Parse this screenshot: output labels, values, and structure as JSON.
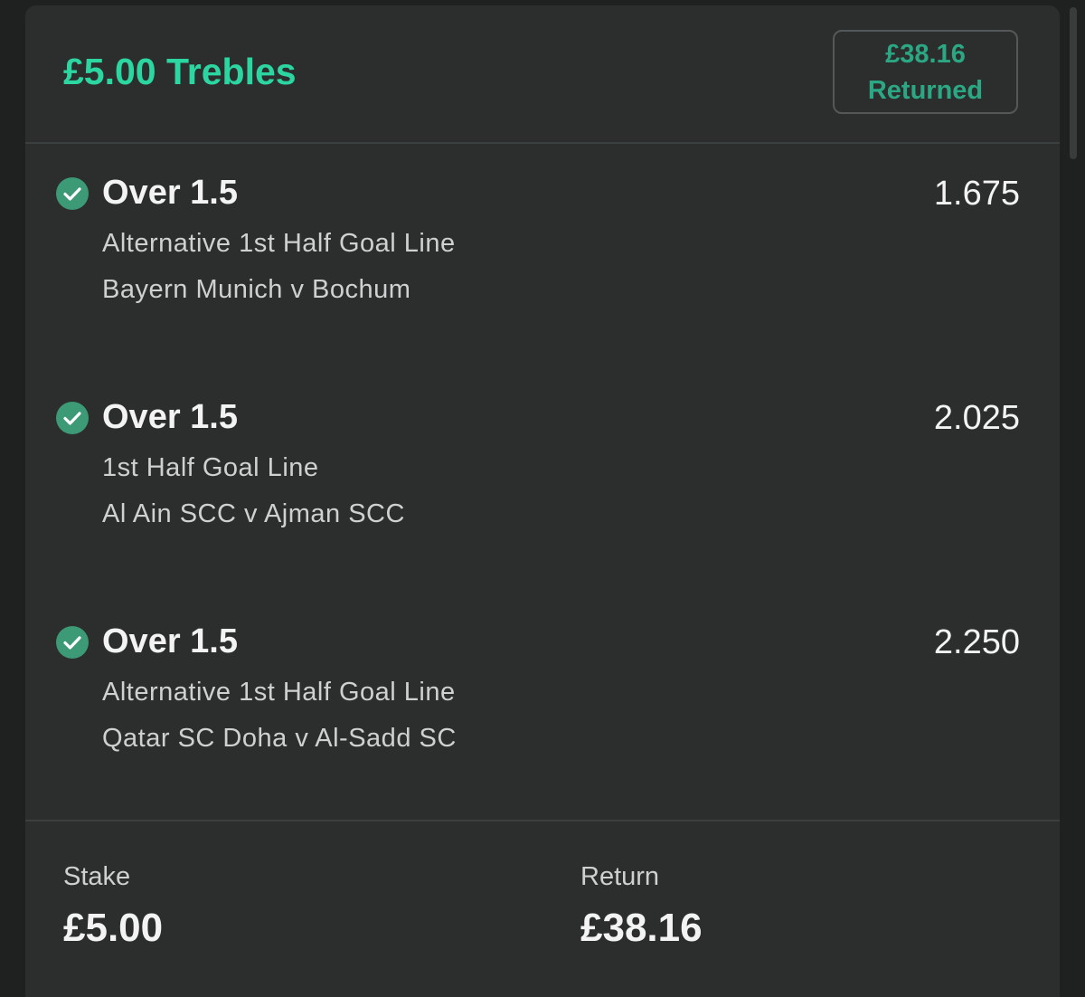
{
  "header": {
    "title": "£5.00 Trebles",
    "returned_amount": "£38.16",
    "returned_label": "Returned"
  },
  "selections": [
    {
      "name": "Over 1.5",
      "market": "Alternative 1st Half Goal Line",
      "event": "Bayern Munich v Bochum",
      "odds": "1.675",
      "status_icon": "check-circle-icon"
    },
    {
      "name": "Over 1.5",
      "market": "1st Half Goal Line",
      "event": "Al Ain SCC v Ajman SCC",
      "odds": "2.025",
      "status_icon": "check-circle-icon"
    },
    {
      "name": "Over 1.5",
      "market": "Alternative 1st Half Goal Line",
      "event": "Qatar SC Doha v Al-Sadd SC",
      "odds": "2.250",
      "status_icon": "check-circle-icon"
    }
  ],
  "footer": {
    "stake_label": "Stake",
    "stake_value": "£5.00",
    "return_label": "Return",
    "return_value": "£38.16"
  },
  "colors": {
    "accent": "#2cd6a1",
    "returned_text": "#2ba883",
    "check_fill": "#3d9a76",
    "card_bg": "#2c2e2e",
    "page_bg": "#1f2020"
  }
}
